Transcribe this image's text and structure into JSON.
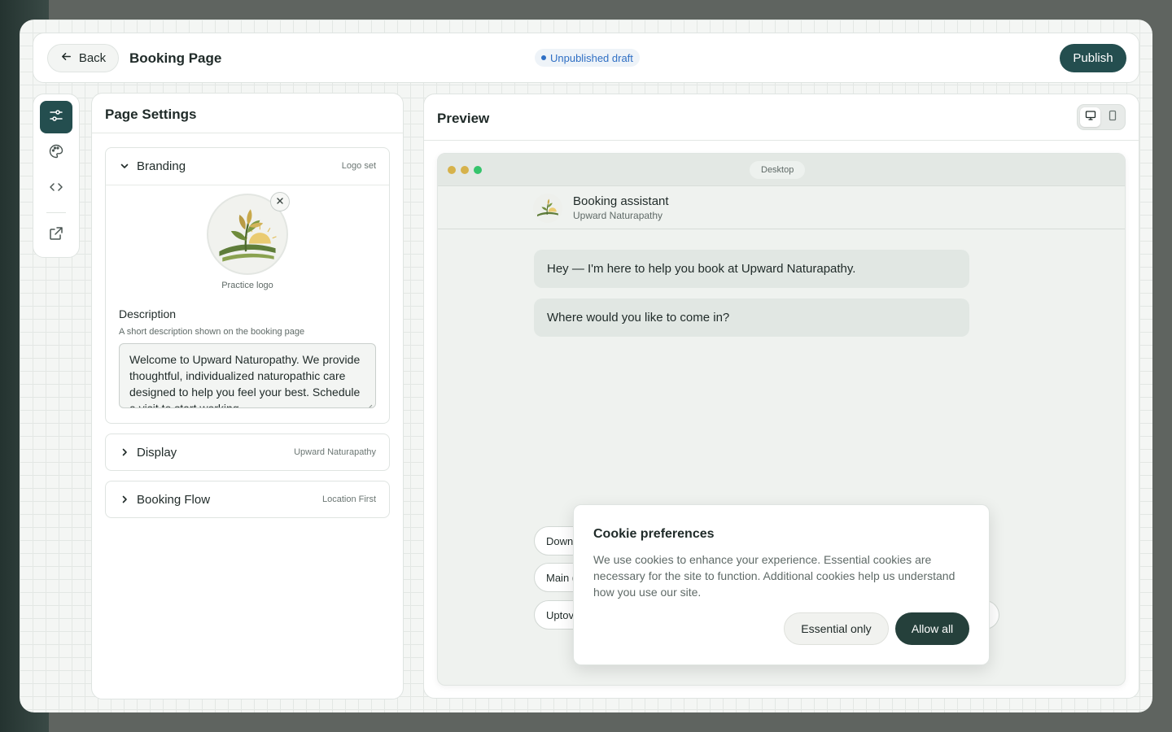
{
  "header": {
    "back_label": "Back",
    "title": "Booking Page",
    "status": "Unpublished draft",
    "publish_label": "Publish"
  },
  "rail": {
    "items": [
      "settings-sliders-icon",
      "palette-icon",
      "code-icon",
      "external-link-icon"
    ]
  },
  "settings": {
    "title": "Page Settings",
    "branding": {
      "label": "Branding",
      "meta": "Logo set",
      "logo_caption": "Practice logo",
      "description_label": "Description",
      "description_help": "A short description shown on the booking page",
      "description_value": "Welcome to Upward Naturopathy. We provide thoughtful, individualized naturopathic care designed to help you feel your best. Schedule a visit to start working"
    },
    "display": {
      "label": "Display",
      "meta": "Upward Naturapathy"
    },
    "booking_flow": {
      "label": "Booking Flow",
      "meta": "Location First"
    }
  },
  "preview": {
    "title": "Preview",
    "device_label": "Desktop",
    "assistant": {
      "name": "Booking assistant",
      "subtitle": "Upward Naturapathy"
    },
    "messages": [
      "Hey — I'm here to help you book at Upward Naturapathy.",
      "Where would you like to come in?"
    ],
    "options": [
      "Down",
      "Main (",
      "Uptov"
    ]
  },
  "cookie": {
    "title": "Cookie preferences",
    "text": "We use cookies to enhance your experience. Essential cookies are necessary for the site to function. Additional cookies help us understand how you use our site.",
    "essential_label": "Essential only",
    "allow_label": "Allow all"
  },
  "colors": {
    "primary": "#244e4f",
    "accent_blue": "#2f6fc4",
    "cookie_primary": "#25403b"
  }
}
